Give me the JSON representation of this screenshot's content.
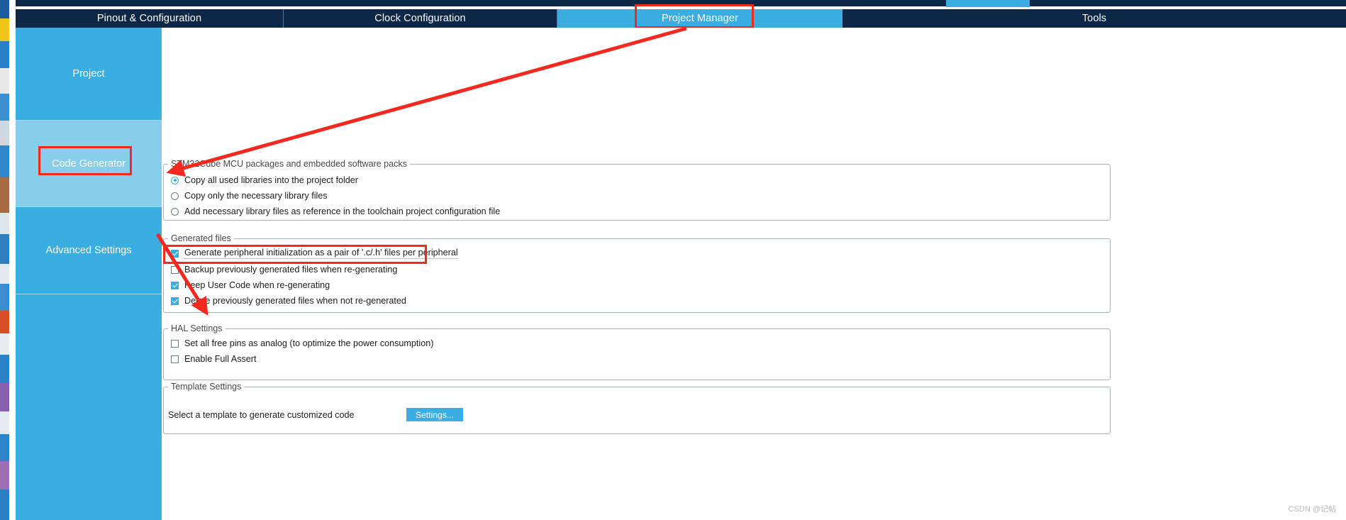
{
  "window": {
    "watermark": "CSDN @记帖"
  },
  "tabs": [
    {
      "label": "Pinout & Configuration",
      "active": false
    },
    {
      "label": "Clock Configuration",
      "active": false
    },
    {
      "label": "Project Manager",
      "active": true
    },
    {
      "label": "Tools",
      "active": false
    }
  ],
  "sidebar": {
    "items": [
      {
        "label": "Project",
        "selected": false
      },
      {
        "label": "Code Generator",
        "selected": true
      },
      {
        "label": "Advanced Settings",
        "selected": false
      }
    ]
  },
  "main": {
    "groups": {
      "packs": {
        "title": "STM32Cube MCU packages and embedded software packs",
        "options": [
          {
            "label": "Copy all used libraries into the project folder",
            "checked": true
          },
          {
            "label": "Copy only the necessary library files",
            "checked": false
          },
          {
            "label": "Add necessary library files as reference in the toolchain project configuration file",
            "checked": false
          }
        ]
      },
      "generated_files": {
        "title": "Generated files",
        "options": [
          {
            "label": "Generate peripheral initialization as a pair of '.c/.h' files per peripheral",
            "checked": true,
            "focused": true
          },
          {
            "label": "Backup previously generated files when re-generating",
            "checked": false,
            "focused": false
          },
          {
            "label": "Keep User Code when re-generating",
            "checked": true,
            "focused": false
          },
          {
            "label": "Delete previously generated files when not re-generated",
            "checked": true,
            "focused": false
          }
        ]
      },
      "hal_settings": {
        "title": "HAL Settings",
        "options": [
          {
            "label": "Set all free pins as analog (to optimize the power consumption)",
            "checked": false
          },
          {
            "label": "Enable Full Assert",
            "checked": false
          }
        ]
      },
      "template_settings": {
        "title": "Template Settings",
        "description": "Select a template to generate customized code",
        "settings_button": "Settings..."
      }
    }
  },
  "annotations": {
    "accent_red": "#f3281e",
    "accent_blue": "#3aaee0",
    "header_navy": "#0d2747"
  }
}
